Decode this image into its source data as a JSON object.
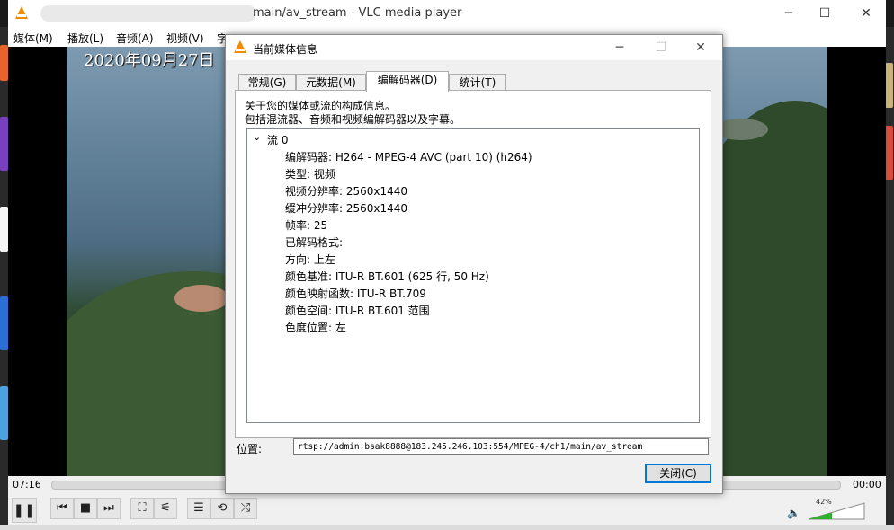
{
  "vlc": {
    "title": "main/av_stream - VLC media player",
    "menu": [
      "媒体(M)",
      "播放(L)",
      "音频(A)",
      "视频(V)",
      "字"
    ],
    "timestamp": "2020年09月27日",
    "time_elapsed": "07:16",
    "time_total": "00:00",
    "volume": "42%",
    "volume_level": 0.42
  },
  "dialog": {
    "title": "当前媒体信息",
    "tabs": [
      "常规(G)",
      "元数据(M)",
      "编解码器(D)",
      "统计(T)"
    ],
    "description_line1": "关于您的媒体或流的构成信息。",
    "description_line2": "包括混流器、音频和视频编解码器以及字幕。",
    "stream": {
      "name": "流 0",
      "props": [
        "编解码器: H264 - MPEG-4 AVC (part 10) (h264)",
        "类型: 视频",
        "视频分辨率: 2560x1440",
        "缓冲分辨率: 2560x1440",
        "帧率: 25",
        "已解码格式:",
        "方向: 上左",
        "颜色基准: ITU-R BT.601 (625 行, 50 Hz)",
        "颜色映射函数: ITU-R BT.709",
        "颜色空间: ITU-R BT.601 范围",
        "色度位置: 左"
      ]
    },
    "location_label": "位置:",
    "location_value": "rtsp://admin:bsak8888@183.245.246.103:554/MPEG-4/ch1/main/av_stream",
    "close_label": "关闭(C)"
  }
}
